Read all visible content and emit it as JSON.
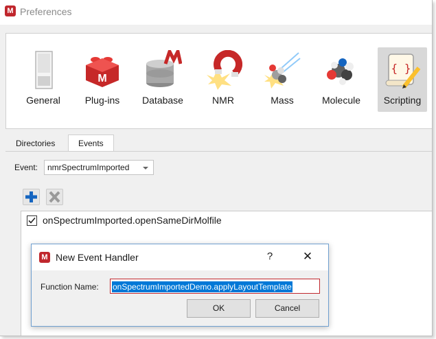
{
  "window": {
    "title": "Preferences",
    "logo_letter": "M"
  },
  "toolbar": {
    "items": [
      {
        "label": "General",
        "icon": "general-panel-icon"
      },
      {
        "label": "Plug-ins",
        "icon": "plugin-brick-icon"
      },
      {
        "label": "Database",
        "icon": "database-icon"
      },
      {
        "label": "NMR",
        "icon": "nmr-magnet-icon"
      },
      {
        "label": "Mass",
        "icon": "mass-spec-icon"
      },
      {
        "label": "Molecule",
        "icon": "molecule-icon"
      },
      {
        "label": "Scripting",
        "icon": "scripting-scroll-icon",
        "active": true
      }
    ]
  },
  "tabs": [
    {
      "label": "Directories",
      "active": false
    },
    {
      "label": "Events",
      "active": true
    }
  ],
  "events": {
    "label": "Event:",
    "selected": "nmrSpectrumImported",
    "handlers": [
      {
        "name": "onSpectrumImported.openSameDirMolfile",
        "checked": true
      }
    ]
  },
  "dialog": {
    "title": "New Event Handler",
    "help_glyph": "?",
    "close_glyph": "✕",
    "function_label": "Function Name:",
    "function_value": "onSpectrumImportedDemo.applyLayoutTemplate",
    "ok_label": "OK",
    "cancel_label": "Cancel"
  },
  "colors": {
    "brand_red": "#c0272d",
    "add_blue": "#1565c0",
    "selection_blue": "#0078d7"
  }
}
